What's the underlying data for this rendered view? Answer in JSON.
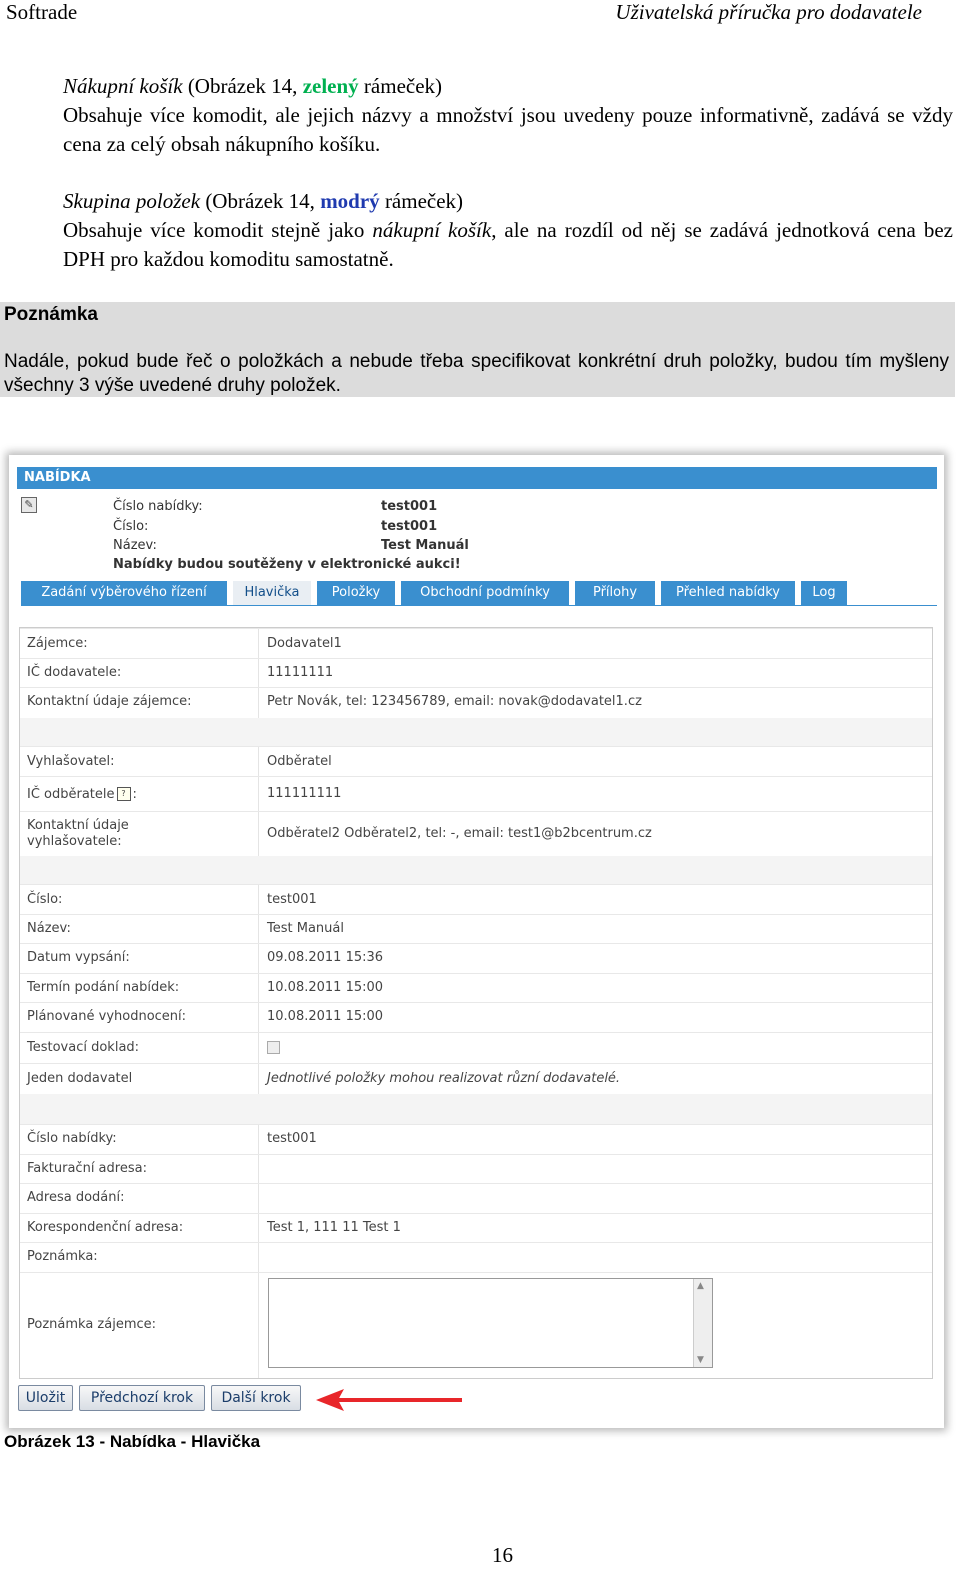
{
  "header": {
    "left": "Softrade",
    "right": "Uživatelská příručka pro dodavatele"
  },
  "paragraphs": {
    "p1_title_italic": "Nákupní košík",
    "p1_title_pre": " (Obrázek 14, ",
    "p1_title_color": "zelený",
    "p1_title_post": " rámeček)",
    "p1_line": "Obsahuje více komodit, ale jejich názvy a množství jsou uvedeny pouze informativně, zadává se vždy cena za celý obsah nákupního košíku.",
    "p2_title_italic": "Skupina položek",
    "p2_title_pre": " (Obrázek 14, ",
    "p2_title_color": "modrý",
    "p2_title_post": " rámeček)",
    "p2_line_a": "Obsahuje více komodit stejně jako ",
    "p2_line_italic": "nákupní košík",
    "p2_line_b": ", ale na rozdíl od něj se zadává jednotková cena bez DPH pro každou komoditu samostatně."
  },
  "note": {
    "title": "Poznámka",
    "text": "Nadále, pokud bude řeč o položkách a nebude třeba specifikovat konkrétní druh položky, budou tím myšleny všechny 3 výše uvedené druhy položek."
  },
  "screenshot": {
    "title": "NABÍDKA",
    "info": {
      "offer_no_label": "Číslo nabídky:",
      "offer_no_value": "test001",
      "number_label": "Číslo:",
      "number_value": "test001",
      "name_label": "Název:",
      "name_value": "Test Manuál",
      "notice": "Nabídky budou soutěženy v elektronické aukci!"
    },
    "tabs": [
      "Zadání výběrového řízení",
      "Hlavička",
      "Položky",
      "Obchodní podmínky",
      "Přílohy",
      "Přehled nabídky",
      "Log"
    ],
    "fields": {
      "zajemce_label": "Zájemce:",
      "zajemce_value": "Dodavatel1",
      "ic_dod_label": "IČ dodavatele:",
      "ic_dod_value": "11111111",
      "kontakt_zaj_label": "Kontaktní údaje zájemce:",
      "kontakt_zaj_value": "Petr Novák, tel: 123456789, email: novak@dodavatel1.cz",
      "vyhlasovatel_label": "Vyhlašovatel:",
      "vyhlasovatel_value": "Odběratel",
      "ic_odb_label": "IČ odběratele",
      "ic_odb_colon": ":",
      "ic_odb_value": "111111111",
      "kontakt_vyhl_label_1": "Kontaktní údaje",
      "kontakt_vyhl_label_2": "vyhlašovatele:",
      "kontakt_vyhl_value": "Odběratel2 Odběratel2, tel: -, email: test1@b2bcentrum.cz",
      "cislo_label": "Číslo:",
      "cislo_value": "test001",
      "nazev_label": "Název:",
      "nazev_value": "Test Manuál",
      "datum_label": "Datum vypsání:",
      "datum_value": "09.08.2011 15:36",
      "termin_label": "Termín podání nabídek:",
      "termin_value": "10.08.2011 15:00",
      "planovane_label": "Plánované vyhodnocení:",
      "planovane_value": "10.08.2011 15:00",
      "testovaci_label": "Testovací doklad:",
      "jeden_label": "Jeden dodavatel",
      "jeden_value": "Jednotlivé položky mohou realizovat různí dodavatelé.",
      "cislo_nab_label": "Číslo nabídky:",
      "cislo_nab_value": "test001",
      "faktur_label": "Fakturační adresa:",
      "adresa_dod_label": "Adresa dodání:",
      "koresp_label": "Korespondenční adresa:",
      "koresp_value": "Test 1, 111 11 Test 1",
      "poznamka_label": "Poznámka:",
      "poznamka_zaj_label": "Poznámka zájemce:"
    },
    "buttons": {
      "save": "Uložit",
      "prev": "Předchozí krok",
      "next": "Další krok"
    },
    "arrow_color": "#e8262a",
    "accent_color": "#3a8fcf"
  },
  "caption": "Obrázek 13 - Nabídka - Hlavička",
  "page_number": "16"
}
